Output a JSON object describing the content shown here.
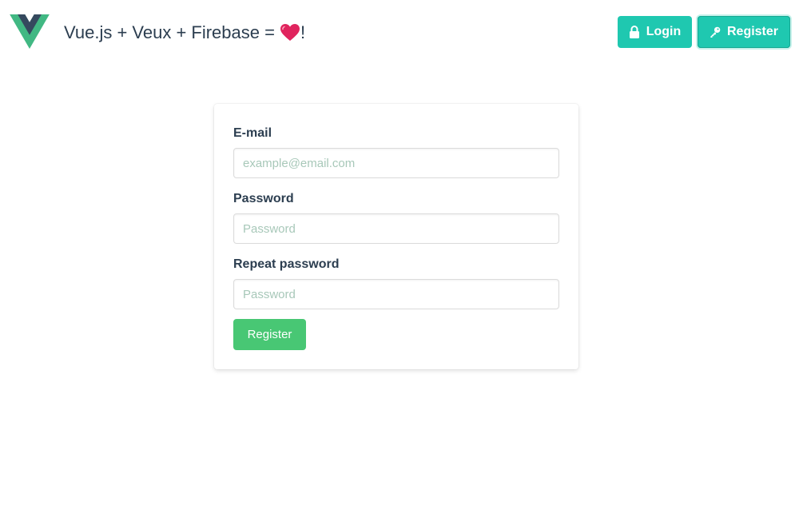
{
  "header": {
    "title_prefix": "Vue.js + Veux + Firebase =",
    "title_suffix": "!",
    "heart_icon": "heart-icon",
    "logo_icon": "vue-logo-icon",
    "login_label": "Login",
    "register_label": "Register"
  },
  "form": {
    "email": {
      "label": "E-mail",
      "placeholder": "example@email.com",
      "value": ""
    },
    "password": {
      "label": "Password",
      "placeholder": "Password",
      "value": ""
    },
    "repeat_password": {
      "label": "Repeat password",
      "placeholder": "Password",
      "value": ""
    },
    "submit_label": "Register"
  },
  "colors": {
    "nav_button": "#1fc8b0",
    "submit_button": "#48c774",
    "text": "#2c3e50",
    "vue_green": "#41b883",
    "vue_dark": "#35495e",
    "heart": "#e0245e"
  }
}
